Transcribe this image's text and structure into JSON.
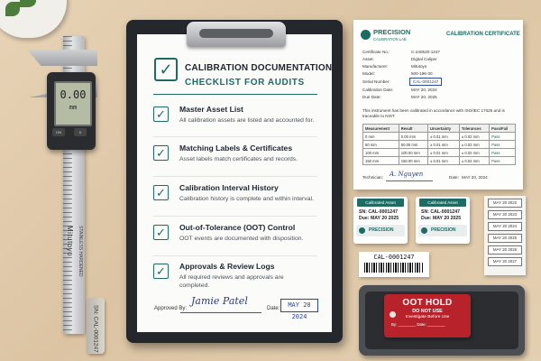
{
  "checklist": {
    "title_line1": "CALIBRATION DOCUMENTATION",
    "title_line2": "CHECKLIST FOR AUDITS",
    "items": [
      {
        "heading": "Master Asset List",
        "desc": "All calibration assets are listed and accounted for."
      },
      {
        "heading": "Matching Labels & Certificates",
        "desc": "Asset labels match certificates and records."
      },
      {
        "heading": "Calibration Interval History",
        "desc": "Calibration history is complete and within interval."
      },
      {
        "heading": "Out-of-Tolerance (OOT) Control",
        "desc": "OOT events are documented with disposition."
      },
      {
        "heading": "Approvals & Review Logs",
        "desc": "All required reviews and approvals are completed."
      }
    ],
    "approved_by_label": "Approved By:",
    "signature": "Jamie Patel",
    "date_label": "Date:",
    "date_value": "MAY 20 2024"
  },
  "caliper": {
    "display_line1": "0.00",
    "display_line2": "mm",
    "brand": "Mitutoyo",
    "sub": "STAINLESS HARDENED",
    "tag_text": "SN: CAL-0001247"
  },
  "certificate": {
    "brand": "PRECISION",
    "brand_sub": "CALIBRATION LAB",
    "title": "CALIBRATION CERTIFICATE",
    "fields": [
      {
        "label": "Certificate No.:",
        "value": "C-240520-1247"
      },
      {
        "label": "Asset:",
        "value": "Digital Caliper"
      },
      {
        "label": "Manufacturer:",
        "value": "Mitutoyo"
      },
      {
        "label": "Model:",
        "value": "500-196-30"
      },
      {
        "label": "Serial Number:",
        "value": "CAL-0001247"
      },
      {
        "label": "Calibration Date:",
        "value": "MAY 20, 2024"
      },
      {
        "label": "Due Date:",
        "value": "MAY 20, 2025"
      }
    ],
    "statement": "This instrument has been calibrated in accordance with ISO/IEC 17025 and is traceable to NIST.",
    "table_headers": [
      "Measurement",
      "Result",
      "Uncertainty",
      "Tolerances",
      "Pass/Fail"
    ],
    "table_rows": [
      [
        "0 mm",
        "0.00 mm",
        "± 0.01 mm",
        "± 0.02 mm",
        "Pass"
      ],
      [
        "50 mm",
        "50.00 mm",
        "± 0.01 mm",
        "± 0.02 mm",
        "Pass"
      ],
      [
        "100 mm",
        "100.00 mm",
        "± 0.01 mm",
        "± 0.02 mm",
        "Pass"
      ],
      [
        "150 mm",
        "150.00 mm",
        "± 0.01 mm",
        "± 0.02 mm",
        "Pass"
      ]
    ],
    "technician_label": "Technician:",
    "technician_sig": "A. Nguyen",
    "date_label": "Date:",
    "date_value": "MAY 20, 2024"
  },
  "asset_labels": [
    {
      "header": "Calibrated Asset",
      "sn": "SN: CAL-0001247",
      "due": "Due: MAY 20 2025",
      "brand": "PRECISION",
      "brand_sub": "CALIBRATION LAB"
    },
    {
      "header": "Calibrated Asset",
      "sn": "SN: CAL-0001247",
      "due": "Due: MAY 20 2025",
      "brand": "PRECISION",
      "brand_sub": "CALIBRATION LAB"
    }
  ],
  "barcode_label": {
    "text": "CAL-0001247"
  },
  "date_strip": [
    "MAY 20 2022",
    "MAY 20 2023",
    "MAY 20 2024",
    "MAY 20 2025",
    "MAY 20 2026",
    "MAY 20 2027"
  ],
  "oot_tag": {
    "title": "OOT HOLD",
    "line2": "DO NOT USE",
    "line3": "Investigate Before Use",
    "by": "By: ________",
    "date": "Date: ________"
  },
  "colors": {
    "accent": "#1d6b63",
    "oot_red": "#b8232b",
    "ink_blue": "#2a3e7a"
  }
}
